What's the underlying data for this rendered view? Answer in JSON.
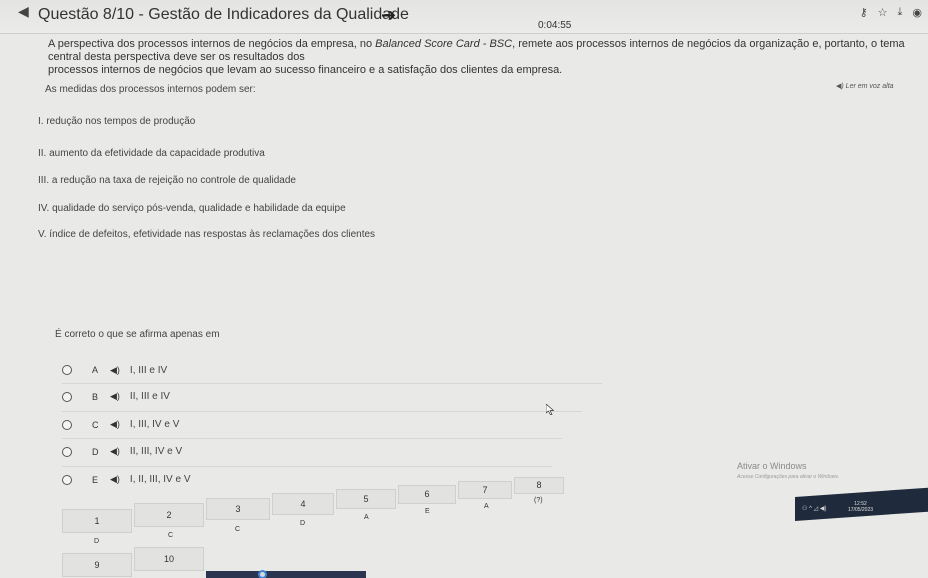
{
  "header": {
    "title": "Questão 8/10 - Gestão de Indicadores da Qualidade",
    "timer": "0:04:55"
  },
  "question": {
    "paragraph_line1_pre": "A perspectiva dos processos internos de negócios da empresa, no ",
    "paragraph_line1_em": "Balanced Score Card - BSC",
    "paragraph_line1_post": ", remete aos processos internos de negócios da organização e, portanto, o tema central desta perspectiva deve ser os resultados dos",
    "paragraph_line2": "processos internos de negócios que levam ao sucesso financeiro e a satisfação dos clientes da empresa.",
    "read_aloud": "Ler em voz alta",
    "measures_label": "As medidas dos processos internos podem ser:",
    "statements": [
      "I. redução nos tempos de produção",
      "II. aumento da efetividade da capacidade produtiva",
      "III. a redução na taxa de rejeição no controle de qualidade",
      "IV. qualidade do serviço pós-venda, qualidade e habilidade da equipe",
      "V. índice de defeitos, efetividade nas respostas às reclamações dos clientes"
    ],
    "prompt": "É correto o que se afirma apenas em"
  },
  "options": [
    {
      "letter": "A",
      "text": "I, III e IV"
    },
    {
      "letter": "B",
      "text": "II, III e IV"
    },
    {
      "letter": "C",
      "text": "I, III, IV e V"
    },
    {
      "letter": "D",
      "text": "II, III, IV e V"
    },
    {
      "letter": "E",
      "text": "I, II, III, IV e V"
    }
  ],
  "speaker_glyph": "◀)",
  "watermark": {
    "title": "Ativar o Windows",
    "subtitle": "Acesse Configurações para ativar o Windows."
  },
  "navigator": {
    "numbers": [
      "1",
      "2",
      "3",
      "4",
      "5",
      "6",
      "7",
      "8",
      "9",
      "10"
    ],
    "answers": [
      "D",
      "C",
      "C",
      "D",
      "A",
      "E",
      "A",
      "(?)"
    ]
  },
  "taskbar": {
    "clock_time": "12:52",
    "clock_date": "17/05/2023"
  },
  "colors": {
    "background": "#e9e9e7",
    "taskbar": "#1f2b3c",
    "accent": "#3b84d8"
  }
}
